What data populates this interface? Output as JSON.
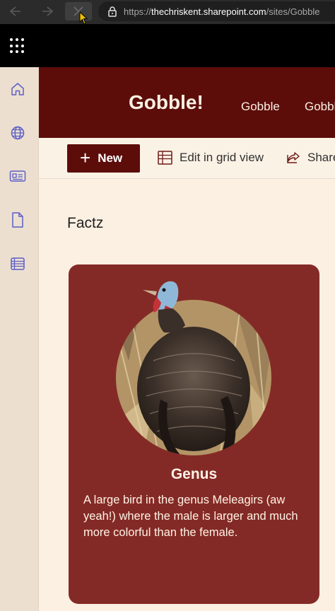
{
  "browser": {
    "url_scheme": "https://",
    "url_host": "thechriskent.sharepoint.com",
    "url_path": "/sites/Gobble"
  },
  "site": {
    "title": "Gobble!",
    "nav_links": [
      "Gobble",
      "Gobble"
    ]
  },
  "command_bar": {
    "new_label": "New",
    "grid_label": "Edit in grid view",
    "share_label": "Share"
  },
  "section": {
    "title": "Factz"
  },
  "card": {
    "title": "Genus",
    "body": "A large bird in the genus Meleagirs (aw yeah!) where the male is larger and much more colorful than the female."
  },
  "colors": {
    "header_bg": "#5c0d0a",
    "card_bg": "#842a26",
    "page_bg": "#fbf0e2",
    "rail_bg": "#ecdfd0"
  },
  "icons": {
    "rail": [
      "home-icon",
      "globe-icon",
      "news-icon",
      "document-icon",
      "list-icon"
    ]
  }
}
